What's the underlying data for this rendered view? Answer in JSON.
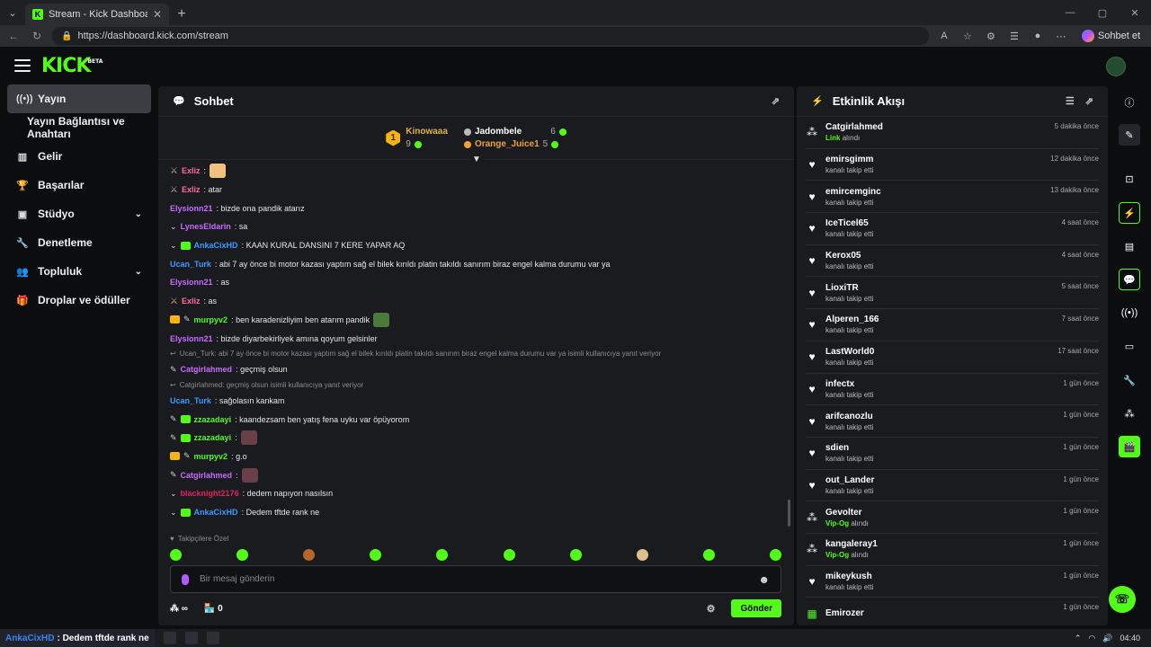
{
  "browser": {
    "tab_title": "Stream - Kick Dashboard",
    "url": "https://dashboard.kick.com/stream",
    "chat_button": "Sohbet et"
  },
  "topbar": {
    "logo": "KICK",
    "beta": "BETA"
  },
  "sidebar": {
    "items": [
      {
        "label": "Yayın",
        "icon": "broadcast-icon"
      },
      {
        "label": "Yayın Bağlantısı ve Anahtarı",
        "icon": ""
      },
      {
        "label": "Gelir",
        "icon": "chart-icon"
      },
      {
        "label": "Başarılar",
        "icon": "trophy-icon"
      },
      {
        "label": "Stüdyo",
        "icon": "studio-icon"
      },
      {
        "label": "Denetleme",
        "icon": "wrench-icon"
      },
      {
        "label": "Topluluk",
        "icon": "people-icon"
      },
      {
        "label": "Droplar ve ödüller",
        "icon": "gift-icon"
      }
    ]
  },
  "chat": {
    "title": "Sohbet",
    "leaderboard": {
      "first": {
        "name": "Kinowaaa",
        "count": "9",
        "rank": "1"
      },
      "second": {
        "name": "Jadombele",
        "count": "6"
      },
      "third": {
        "name": "Orange_Juice1",
        "count": "5"
      }
    },
    "messages": [
      {
        "user": "Exliz",
        "text": ":",
        "color": "#ff6aa0",
        "badges": [
          "sword"
        ],
        "emote": "#f1c27d"
      },
      {
        "user": "Exliz",
        "text": ": atar",
        "color": "#ff6aa0",
        "badges": [
          "sword"
        ]
      },
      {
        "user": "Elysionn21",
        "text": ": bizde ona pandik atarız",
        "color": "#c86bff",
        "badges": []
      },
      {
        "user": "LynesEldarin",
        "text": ": sa",
        "color": "#c86bff",
        "badges": [
          "chev"
        ]
      },
      {
        "user": "AnkaCixHD",
        "text": ": KAAN KURAL DANSINI 7 KERE YAPAR AQ",
        "color": "#3b9bff",
        "badges": [
          "chev",
          "sub"
        ]
      },
      {
        "user": "Ucan_Turk",
        "text": ": abi 7 ay önce bi motor kazası yaptım sağ el bilek kırıldı platin takıldı sanırım biraz engel kalma durumu var ya",
        "color": "#3b9bff",
        "badges": []
      },
      {
        "user": "Elysionn21",
        "text": ": as",
        "color": "#c86bff",
        "badges": []
      },
      {
        "user": "Exliz",
        "text": ": as",
        "color": "#ff6aa0",
        "badges": [
          "sword"
        ]
      },
      {
        "user": "murpyv2",
        "text": ": ben karadenizliyim ben atarım pandik",
        "color": "#53fc18",
        "badges": [
          "crown",
          "pen"
        ],
        "emote": "#4a7a3a"
      },
      {
        "user": "Elysionn21",
        "text": ": bizde diyarbekirliyek amına qoyum gelsinler",
        "color": "#c86bff",
        "badges": []
      },
      {
        "reply": "Ucan_Turk: abi 7 ay önce bi motor kazası yaptım sağ el bilek kırıldı platin takıldı sanırım biraz engel kalma durumu var ya isimli kullanıcıya yanıt veriyor"
      },
      {
        "user": "Catgirlahmed",
        "text": ": geçmiş olsun",
        "color": "#c86bff",
        "badges": [
          "pen"
        ]
      },
      {
        "reply": "Catgirlahmed: geçmiş olsun isimli kullanıcıya yanıt veriyor"
      },
      {
        "user": "Ucan_Turk",
        "text": ": sağolasın kankam",
        "color": "#3b9bff",
        "badges": []
      },
      {
        "user": "zzazadayi",
        "text": ": kaandezsam ben yatış fena uyku var öpüyorom",
        "color": "#53fc18",
        "badges": [
          "pen",
          "sub"
        ]
      },
      {
        "user": "zzazadayi",
        "text": ":",
        "color": "#53fc18",
        "badges": [
          "pen",
          "sub"
        ],
        "emote": "#6a4048"
      },
      {
        "user": "murpyv2",
        "text": ": g.o",
        "color": "#53fc18",
        "badges": [
          "crown",
          "pen"
        ]
      },
      {
        "user": "Catgirlahmed",
        "text": ":",
        "color": "#c86bff",
        "badges": [
          "pen"
        ],
        "emote": "#6a4048"
      },
      {
        "user": "blacknight2176",
        "text": ": dedem napıyon nasılsın",
        "color": "#e0245e",
        "badges": [
          "chev"
        ]
      },
      {
        "user": "AnkaCixHD",
        "text": ": Dedem tftde rank ne",
        "color": "#3b9bff",
        "badges": [
          "chev",
          "sub"
        ]
      }
    ],
    "emote_label": "Takipçilere Özel",
    "input_placeholder": "Bir mesaj gönderin",
    "foot_count": "0",
    "send_label": "Gönder"
  },
  "activity": {
    "title": "Etkinlik Akışı",
    "items": [
      {
        "name": "Catgirlahmed",
        "desc_green": "Link",
        "desc": "alındı",
        "time": "5 dakika önce",
        "icon": "gift-icon"
      },
      {
        "name": "emirsgimm",
        "desc": "kanalı takip etti",
        "time": "12 dakika önce",
        "icon": "heart-icon"
      },
      {
        "name": "emircemginc",
        "desc": "kanalı takip etti",
        "time": "13 dakika önce",
        "icon": "heart-icon"
      },
      {
        "name": "IceTicel65",
        "desc": "kanalı takip etti",
        "time": "4 saat önce",
        "icon": "heart-icon"
      },
      {
        "name": "Kerox05",
        "desc": "kanalı takip etti",
        "time": "4 saat önce",
        "icon": "heart-icon"
      },
      {
        "name": "LioxiTR",
        "desc": "kanalı takip etti",
        "time": "5 saat önce",
        "icon": "heart-icon"
      },
      {
        "name": "Alperen_166",
        "desc": "kanalı takip etti",
        "time": "7 saat önce",
        "icon": "heart-icon"
      },
      {
        "name": "LastWorld0",
        "desc": "kanalı takip etti",
        "time": "17 saat önce",
        "icon": "heart-icon"
      },
      {
        "name": "infectx",
        "desc": "kanalı takip etti",
        "time": "1 gün önce",
        "icon": "heart-icon"
      },
      {
        "name": "arifcanozlu",
        "desc": "kanalı takip etti",
        "time": "1 gün önce",
        "icon": "heart-icon"
      },
      {
        "name": "sdien",
        "desc": "kanalı takip etti",
        "time": "1 gün önce",
        "icon": "heart-icon"
      },
      {
        "name": "out_Lander",
        "desc": "kanalı takip etti",
        "time": "1 gün önce",
        "icon": "heart-icon"
      },
      {
        "name": "Gevolter",
        "desc_green": "Vip-Og",
        "desc": "alındı",
        "time": "1 gün önce",
        "icon": "gift-icon"
      },
      {
        "name": "kangaleray1",
        "desc_green": "Vip-Og",
        "desc": "alındı",
        "time": "1 gün önce",
        "icon": "gift-icon"
      },
      {
        "name": "mikeykush",
        "desc": "kanalı takip etti",
        "time": "1 gün önce",
        "icon": "heart-icon"
      },
      {
        "name": "Emirozer",
        "desc": "",
        "time": "1 gün önce",
        "icon": "sub-icon"
      }
    ]
  },
  "taskbar": {
    "notif_user": "AnkaCixHD",
    "notif_text": ": Dedem tftde rank ne",
    "time": "04:40"
  }
}
